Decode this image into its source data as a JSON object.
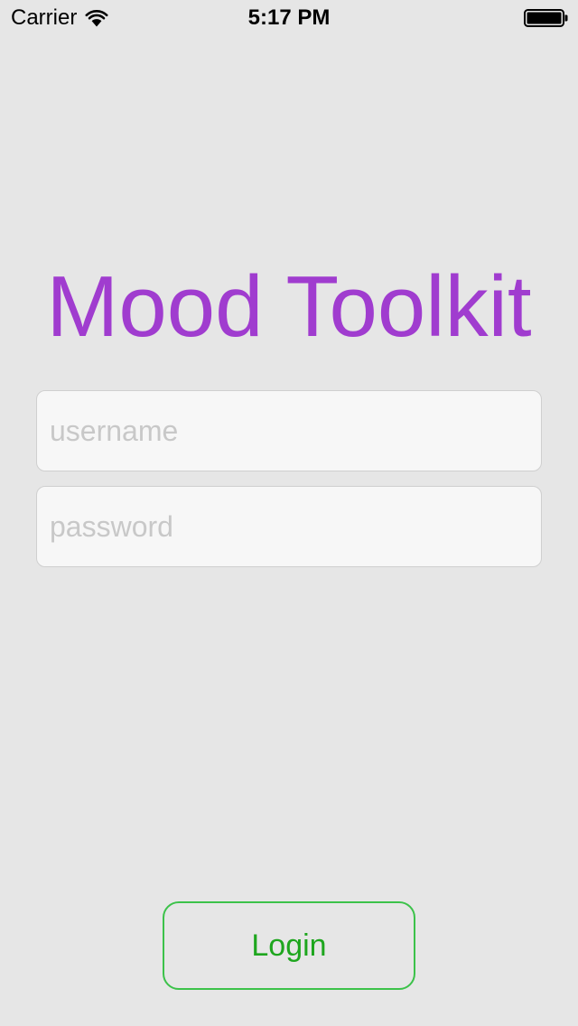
{
  "status_bar": {
    "carrier": "Carrier",
    "time": "5:17 PM",
    "wifi_icon": "wifi-icon",
    "battery_icon": "battery-icon"
  },
  "app": {
    "title": "Mood Toolkit",
    "title_color": "#a03ccf"
  },
  "form": {
    "username": {
      "value": "",
      "placeholder": "username"
    },
    "password": {
      "value": "",
      "placeholder": "password"
    },
    "login_label": "Login",
    "login_color": "#1ea61e",
    "login_border_color": "#3cc24a"
  },
  "colors": {
    "background": "#e6e6e6",
    "field_background": "#f7f7f7",
    "placeholder": "#c8c8c8"
  }
}
